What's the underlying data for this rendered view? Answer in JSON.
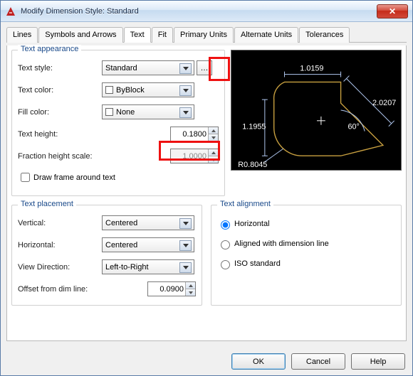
{
  "window": {
    "title": "Modify Dimension Style: Standard"
  },
  "tabs": [
    "Lines",
    "Symbols and Arrows",
    "Text",
    "Fit",
    "Primary Units",
    "Alternate Units",
    "Tolerances"
  ],
  "active_tab": 2,
  "appearance": {
    "legend": "Text appearance",
    "style_label": "Text style:",
    "style_value": "Standard",
    "color_label": "Text color:",
    "color_value": "ByBlock",
    "fill_label": "Fill color:",
    "fill_value": "None",
    "height_label": "Text height:",
    "height_value": "0.1800",
    "frac_label": "Fraction height scale:",
    "frac_value": "1.0000",
    "frame_label": "Draw frame around text"
  },
  "placement": {
    "legend": "Text placement",
    "vert_label": "Vertical:",
    "vert_value": "Centered",
    "horiz_label": "Horizontal:",
    "horiz_value": "Centered",
    "viewdir_label": "View Direction:",
    "viewdir_value": "Left-to-Right",
    "offset_label": "Offset from dim line:",
    "offset_value": "0.0900"
  },
  "alignment": {
    "legend": "Text alignment",
    "opt1": "Horizontal",
    "opt2": "Aligned with dimension line",
    "opt3": "ISO standard"
  },
  "preview": {
    "d1": "1.0159",
    "d2": "1.1955",
    "d3": "2.0207",
    "ang": "60°",
    "rad": "R0.8045"
  },
  "buttons": {
    "ok": "OK",
    "cancel": "Cancel",
    "help": "Help"
  }
}
